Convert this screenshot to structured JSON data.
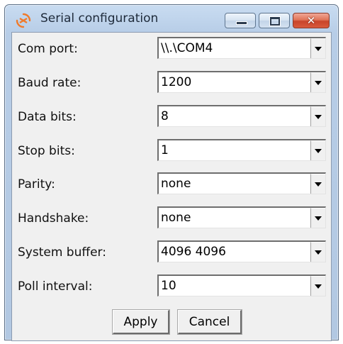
{
  "window": {
    "title": "Serial configuration",
    "close_glyph": "✕"
  },
  "fields": [
    {
      "label": "Com port:",
      "value": "\\\\.\\COM4"
    },
    {
      "label": "Baud rate:",
      "value": "1200"
    },
    {
      "label": "Data bits:",
      "value": "8"
    },
    {
      "label": "Stop bits:",
      "value": "1"
    },
    {
      "label": "Parity:",
      "value": "none"
    },
    {
      "label": "Handshake:",
      "value": "none"
    },
    {
      "label": "System buffer:",
      "value": "4096 4096"
    },
    {
      "label": "Poll interval:",
      "value": "10"
    }
  ],
  "buttons": {
    "apply": "Apply",
    "cancel": "Cancel"
  },
  "icons": {
    "app": "serial-app-icon",
    "minimize": "minimize-icon",
    "maximize": "maximize-icon",
    "close": "close-icon",
    "dropdown": "chevron-down-icon"
  },
  "colors": {
    "app_icon": "#f07a2a",
    "close_button": "#d0482c"
  }
}
